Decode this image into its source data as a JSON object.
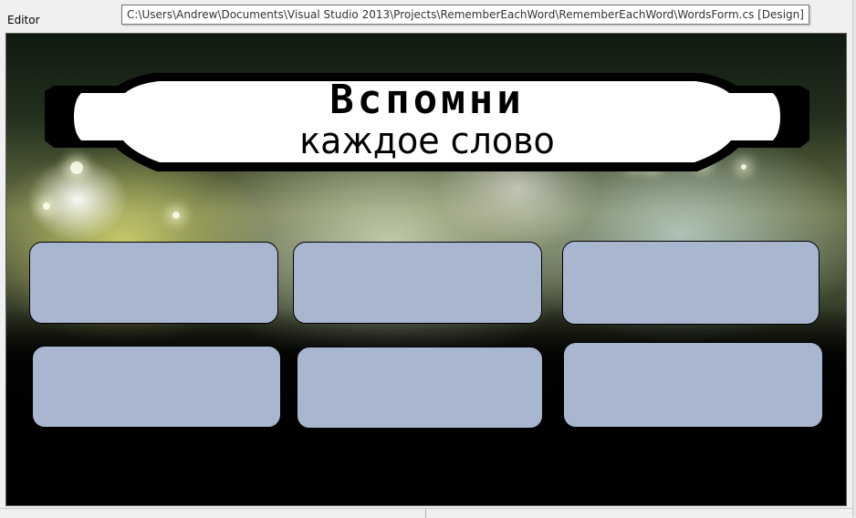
{
  "designer": {
    "panel_label": "Editor",
    "file_path": "C:\\Users\\Andrew\\Documents\\Visual Studio 2013\\Projects\\RememberEachWord\\RememberEachWord\\WordsForm.cs [Design]"
  },
  "form": {
    "banner_title": "Вспомни",
    "banner_subtitle": "каждое слово",
    "word_boxes": [
      "",
      "",
      "",
      "",
      "",
      ""
    ],
    "colors": {
      "word_box_fill": "#a8b6d0",
      "banner_fill": "#ffffff",
      "banner_border": "#000000"
    }
  }
}
